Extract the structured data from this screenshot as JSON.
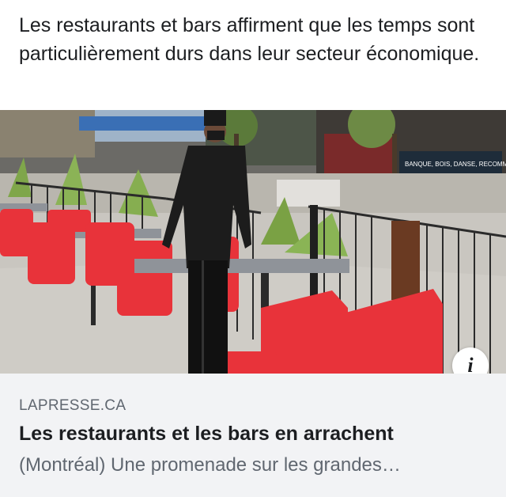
{
  "post": {
    "text": "Les restaurants et bars affirment que les temps sont particulièrement durs dans leur secteur économique."
  },
  "link_preview": {
    "domain": "LAPRESSE.CA",
    "title": "Les restaurants et les bars en arrachent",
    "description": "(Montréal) Une promenade sur les grandes…",
    "info_icon": "info-icon",
    "info_icon_glyph": "i",
    "image": {
      "sign_text": "BANQUE, BOIS, DANSE, RECOMMENCE...",
      "colors": {
        "chairs": "#e8333a",
        "tables": "#8f9399",
        "railing": "#2b2b2b",
        "pavement": "#c9c6c0"
      }
    }
  }
}
